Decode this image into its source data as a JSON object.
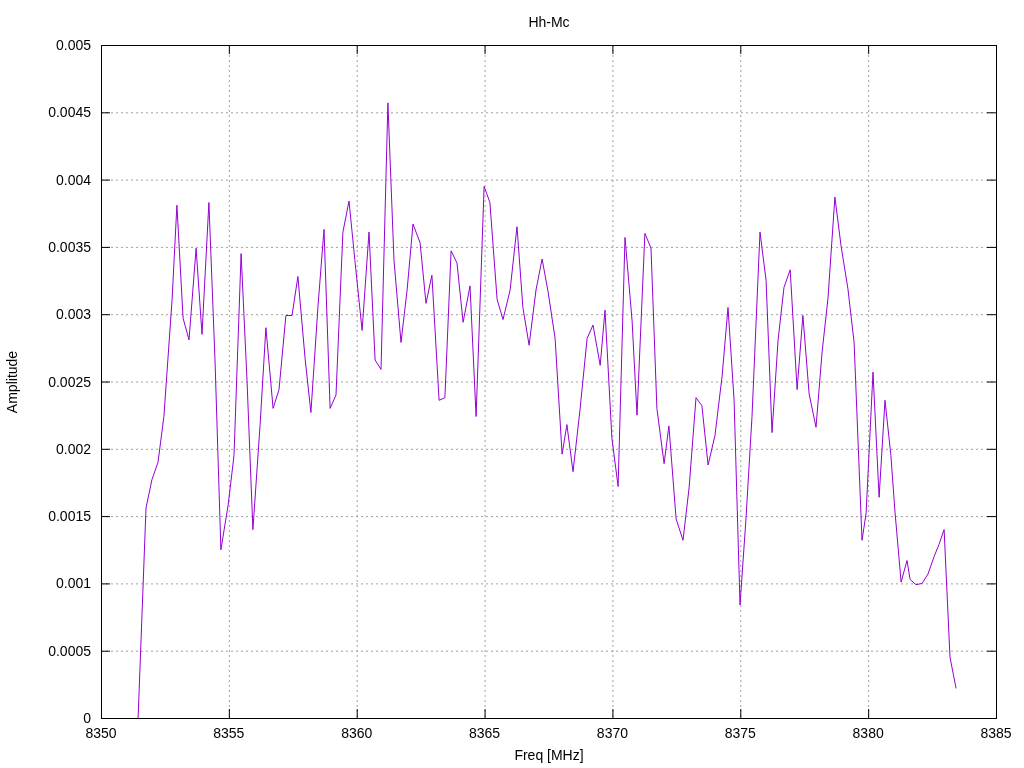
{
  "chart_data": {
    "type": "line",
    "grid": true,
    "title": "Hh-Mc",
    "xlabel": "Freq [MHz]",
    "ylabel": "Amplitude",
    "xlim": [
      8350,
      8385
    ],
    "ylim": [
      0,
      0.005
    ],
    "xticks": [
      8350,
      8355,
      8360,
      8365,
      8370,
      8375,
      8380,
      8385
    ],
    "yticks": [
      {
        "value": 0,
        "label": "0"
      },
      {
        "value": 0.0005,
        "label": "0.0005"
      },
      {
        "value": 0.001,
        "label": "0.001"
      },
      {
        "value": 0.0015,
        "label": "0.0015"
      },
      {
        "value": 0.002,
        "label": "0.002"
      },
      {
        "value": 0.0025,
        "label": "0.0025"
      },
      {
        "value": 0.003,
        "label": "0.003"
      },
      {
        "value": 0.0035,
        "label": "0.0035"
      },
      {
        "value": 0.004,
        "label": "0.004"
      },
      {
        "value": 0.0045,
        "label": "0.0045"
      },
      {
        "value": 0.005,
        "label": "0.005"
      }
    ],
    "x": [
      8351.45,
      8351.76,
      8351.99,
      8352.23,
      8352.46,
      8352.78,
      8352.97,
      8353.21,
      8353.44,
      8353.72,
      8353.95,
      8354.22,
      8354.46,
      8354.69,
      8354.97,
      8355.2,
      8355.48,
      8355.71,
      8355.94,
      8356.22,
      8356.45,
      8356.73,
      8356.96,
      8357.23,
      8357.47,
      8357.7,
      8357.98,
      8358.21,
      8358.49,
      8358.72,
      8358.96,
      8359.19,
      8359.46,
      8359.7,
      8359.93,
      8360.21,
      8360.48,
      8360.72,
      8360.95,
      8361.22,
      8361.46,
      8361.73,
      8361.97,
      8362.2,
      8362.48,
      8362.71,
      8362.94,
      8363.22,
      8363.45,
      8363.69,
      8363.92,
      8364.16,
      8364.43,
      8364.67,
      8364.98,
      8365.21,
      8365.49,
      8365.72,
      8366.0,
      8366.27,
      8366.5,
      8366.74,
      8367.01,
      8367.25,
      8367.48,
      8367.76,
      8368.03,
      8368.22,
      8368.46,
      8368.73,
      8369.01,
      8369.24,
      8369.52,
      8369.71,
      8369.98,
      8370.22,
      8370.49,
      8370.77,
      8370.96,
      8371.27,
      8371.51,
      8371.74,
      8372.02,
      8372.21,
      8372.49,
      8372.76,
      8373.0,
      8373.27,
      8373.5,
      8373.74,
      8374.01,
      8374.29,
      8374.52,
      8374.76,
      8374.99,
      8375.22,
      8375.46,
      8375.77,
      8376.01,
      8376.24,
      8376.48,
      8376.71,
      8376.95,
      8377.22,
      8377.45,
      8377.69,
      8377.96,
      8378.2,
      8378.43,
      8378.7,
      8378.94,
      8379.21,
      8379.45,
      8379.76,
      8379.92,
      8380.19,
      8380.43,
      8380.66,
      8380.89,
      8381.05,
      8381.29,
      8381.52,
      8381.64,
      8381.87,
      8382.11,
      8382.34,
      8382.58,
      8382.77,
      8382.97,
      8383.2,
      8383.44
    ],
    "series": [
      {
        "color": "#9400d3",
        "values": [
          0,
          0.00156,
          0.00177,
          0.0019,
          0.00224,
          0.00311,
          0.00381,
          0.00297,
          0.00281,
          0.00349,
          0.00285,
          0.00383,
          0.00266,
          0.00125,
          0.00158,
          0.00195,
          0.00345,
          0.00251,
          0.0014,
          0.00218,
          0.0029,
          0.0023,
          0.00244,
          0.00299,
          0.00299,
          0.00328,
          0.00267,
          0.00227,
          0.00307,
          0.00363,
          0.0023,
          0.0024,
          0.00361,
          0.00384,
          0.0034,
          0.00288,
          0.00361,
          0.00266,
          0.00259,
          0.00457,
          0.0034,
          0.00279,
          0.00318,
          0.00367,
          0.00353,
          0.00308,
          0.00329,
          0.00236,
          0.00238,
          0.00347,
          0.00338,
          0.00294,
          0.00321,
          0.00224,
          0.00395,
          0.00383,
          0.00311,
          0.00296,
          0.00318,
          0.00365,
          0.00305,
          0.00277,
          0.00318,
          0.00341,
          0.00317,
          0.00282,
          0.00196,
          0.00218,
          0.00183,
          0.00229,
          0.00282,
          0.00292,
          0.00262,
          0.00303,
          0.00208,
          0.00172,
          0.00357,
          0.00295,
          0.00225,
          0.0036,
          0.00349,
          0.0023,
          0.00189,
          0.00217,
          0.00148,
          0.00132,
          0.00171,
          0.00238,
          0.00232,
          0.00188,
          0.0021,
          0.00254,
          0.00305,
          0.00236,
          0.00084,
          0.00147,
          0.00224,
          0.00361,
          0.00325,
          0.00212,
          0.00281,
          0.0032,
          0.00333,
          0.00244,
          0.00299,
          0.00241,
          0.00216,
          0.00272,
          0.00312,
          0.00387,
          0.00351,
          0.00319,
          0.00279,
          0.00132,
          0.00152,
          0.00257,
          0.00164,
          0.00236,
          0.00195,
          0.00153,
          0.00101,
          0.00117,
          0.00103,
          0.00099,
          0.001,
          0.00107,
          0.0012,
          0.00129,
          0.0014,
          0.00045,
          0.00022
        ]
      }
    ]
  }
}
